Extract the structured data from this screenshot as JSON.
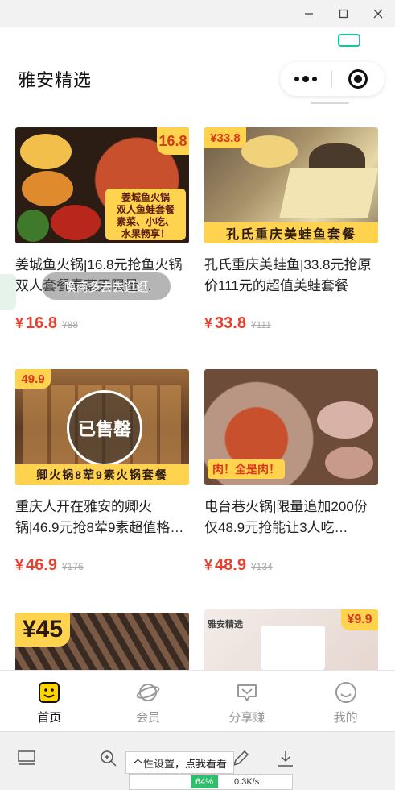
{
  "window": {
    "minimize_icon": "minimize-icon",
    "maximize_icon": "maximize-icon",
    "close_icon": "close-icon"
  },
  "header": {
    "title": "雅安精选",
    "more_icon": "more-dots-icon",
    "close_target_icon": "target-icon"
  },
  "toast": "唤商多去去逛逛",
  "products": [
    {
      "title": "姜城鱼火锅|16.8元抢鱼火锅双人套餐素菜无限量…",
      "price": "16.8",
      "original_price": "88",
      "image_badge": "16.8",
      "image_lines": [
        "姜城鱼火锅",
        "双人鱼蛙套餐",
        "素菜、小吃、",
        "水果畅享！"
      ],
      "image_colors": [
        "#2b1c14",
        "#c8502c"
      ]
    },
    {
      "title": "孔氏重庆美蛙鱼|33.8元抢原价111元的超值美蛙套餐",
      "price": "33.8",
      "original_price": "111",
      "image_badge": "¥33.8",
      "image_banner": "孔氏重庆美蛙鱼套餐",
      "image_colors": [
        "#6b5a45",
        "#e9d8a8"
      ]
    },
    {
      "title": "重庆人开在雅安的卿火锅|46.9元抢8荤9素超值格子…",
      "price": "46.9",
      "original_price": "176",
      "image_badge": "49.9",
      "image_banner": "卿火锅8荤9素火锅套餐",
      "sold_out": "已售罄",
      "image_colors": [
        "#5c3a22",
        "#9a6a3c"
      ]
    },
    {
      "title": "电台巷火锅|限量追加200份仅48.9元抢能让3人吃…",
      "price": "48.9",
      "original_price": "134",
      "image_badge": "肉！全是肉！",
      "image_colors": [
        "#6d4d3a",
        "#b99584"
      ]
    },
    {
      "title": "",
      "price": "",
      "original_price": "",
      "image_badge": "¥45",
      "image_colors": [
        "#3a2b22",
        "#7a5a44"
      ]
    },
    {
      "title": "",
      "price": "",
      "original_price": "",
      "image_badge": "¥9.9",
      "image_corner": "雅安精选",
      "image_colors": [
        "#f3ece8",
        "#e6d7d0"
      ]
    }
  ],
  "tabbar": {
    "tabs": [
      {
        "label": "首页",
        "icon": "home-face-icon",
        "active": true
      },
      {
        "label": "会员",
        "icon": "planet-icon",
        "active": false
      },
      {
        "label": "分享赚",
        "icon": "share-heart-icon",
        "active": false
      },
      {
        "label": "我的",
        "icon": "smile-icon",
        "active": false
      }
    ]
  },
  "sysbar": {
    "tooltip": "个性设置，点我看看",
    "battery_pct": "64%",
    "net_speed": "0.3K/s"
  },
  "colors": {
    "price": "#e8402e",
    "accent_yellow": "#ffd34e",
    "teal": "#19c3a0"
  }
}
